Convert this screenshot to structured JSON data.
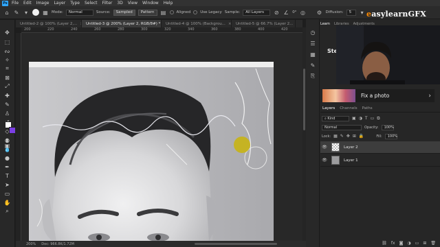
{
  "app": {
    "logo": "Ps"
  },
  "menu": [
    "File",
    "Edit",
    "Image",
    "Layer",
    "Type",
    "Select",
    "Filter",
    "3D",
    "View",
    "Window",
    "Help"
  ],
  "options_bar": {
    "mode_label": "Mode:",
    "mode_value": "Normal",
    "source_label": "Source:",
    "source_sampled": "Sampled",
    "source_pattern": "Pattern",
    "aligned": "Aligned",
    "use_legacy": "Use Legacy",
    "sample_label": "Sample:",
    "sample_value": "All Layers",
    "angle": "0°",
    "diffusion_label": "Diffusion:",
    "diffusion_value": "5"
  },
  "doc_tabs": [
    {
      "label": "Untitled-2 @ 100% (Layer 2,...",
      "active": false
    },
    {
      "label": "Untitled-3 @ 200% (Layer 2, RGB/8#) *",
      "active": true
    },
    {
      "label": "Untitled-4 @ 100% (Backgrou...",
      "active": false
    },
    {
      "label": "Untitled-5 @ 66.7% (Layer 2...",
      "active": false
    }
  ],
  "ruler": [
    "200",
    "220",
    "240",
    "260",
    "280",
    "300",
    "320",
    "340",
    "360",
    "380",
    "400",
    "420"
  ],
  "status": {
    "zoom": "200%",
    "doc": "Doc: 966.8K/1.72M"
  },
  "brand": {
    "first": "e",
    "rest": "asylearnGFX"
  },
  "learn": {
    "tabs": [
      "Learn",
      "Libraries",
      "Adjustments"
    ],
    "title": "Step",
    "fix_label": "Fix a photo"
  },
  "layers_panel": {
    "tabs": [
      "Layers",
      "Channels",
      "Paths"
    ],
    "kind": "Kind",
    "blend": "Normal",
    "opacity_label": "Opacity:",
    "opacity_value": "100%",
    "lock_label": "Lock:",
    "fill_label": "Fill:",
    "fill_value": "100%",
    "layers": [
      {
        "name": "Layer 2",
        "selected": true
      },
      {
        "name": "Layer 1",
        "selected": false
      }
    ]
  },
  "colors": {
    "accent_purple": "#7b3fe4",
    "brand_orange": "#ff8a00",
    "brush_cursor": "#c8b414"
  }
}
